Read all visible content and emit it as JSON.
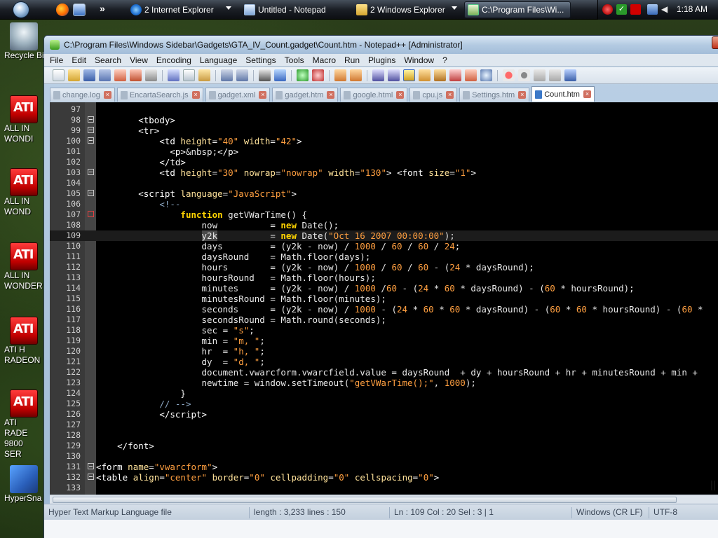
{
  "taskbar": {
    "quick_launch_chevron": "»",
    "buttons": [
      {
        "label": "2 Internet Explorer",
        "icon": "ie-icon"
      },
      {
        "label": "Untitled - Notepad",
        "icon": "notepad-icon"
      },
      {
        "label": "2 Windows Explorer",
        "icon": "folder-icon"
      },
      {
        "label": "C:\\Program Files\\Wi...",
        "icon": "folder-icon"
      }
    ],
    "clock": "1:18 AM"
  },
  "desktop_icons": [
    {
      "label": "Recycle Bi",
      "icon": "recycle-bin-icon"
    },
    {
      "badge": "ATI",
      "label": "ALL IN WONDI",
      "icon": "ati-icon"
    },
    {
      "badge": "ATI",
      "label": "ALL IN WOND",
      "icon": "ati-icon"
    },
    {
      "badge": "ATI",
      "label": "ALL IN WONDER",
      "icon": "ati-icon"
    },
    {
      "badge": "ATI",
      "label": "ATI H RADEON",
      "icon": "ati-icon"
    },
    {
      "badge": "ATI",
      "label": "ATI RADE 9800 SER",
      "icon": "ati-icon"
    },
    {
      "label": "HyperSna",
      "icon": "hypersnap-icon"
    }
  ],
  "window": {
    "title": "C:\\Program Files\\Windows Sidebar\\Gadgets\\GTA_IV_Count.gadget\\Count.htm - Notepad++ [Administrator]",
    "menu": [
      "File",
      "Edit",
      "Search",
      "View",
      "Encoding",
      "Language",
      "Settings",
      "Tools",
      "Macro",
      "Run",
      "Plugins",
      "Window",
      "?"
    ],
    "tabs": [
      {
        "label": "change.log",
        "active": false
      },
      {
        "label": "EncartaSearch.js",
        "active": false
      },
      {
        "label": "gadget.xml",
        "active": false
      },
      {
        "label": "gadget.htm",
        "active": false
      },
      {
        "label": "google.html",
        "active": false
      },
      {
        "label": "cpu.js",
        "active": false
      },
      {
        "label": "Settings.htm",
        "active": false
      },
      {
        "label": "Count.htm",
        "active": true
      }
    ],
    "status": {
      "filetype": "Hyper Text Markup Language file",
      "length": "length : 3,233    lines : 150",
      "position": "Ln : 109    Col : 20    Sel : 3 | 1",
      "eol": "Windows (CR LF)",
      "encoding": "UTF-8"
    }
  },
  "editor": {
    "current_line": 109,
    "lines": [
      {
        "n": "97",
        "fold": "",
        "html": ""
      },
      {
        "n": "98",
        "fold": "open",
        "html": "        <span class='tag'>&lt;tbody&gt;</span>"
      },
      {
        "n": "99",
        "fold": "open",
        "html": "        <span class='tag'>&lt;tr&gt;</span>"
      },
      {
        "n": "100",
        "fold": "open",
        "html": "            <span class='tag'>&lt;td</span> <span class='attr'>height</span>=<span class='str'>\"40\"</span> <span class='attr'>width</span>=<span class='str'>\"42\"</span><span class='tag'>&gt;</span>"
      },
      {
        "n": "101",
        "fold": "",
        "html": "              <span class='tag'>&lt;p&gt;</span>&amp;nbsp;<span class='tag'>&lt;/p&gt;</span>"
      },
      {
        "n": "102",
        "fold": "",
        "html": "            <span class='tag'>&lt;/td&gt;</span>"
      },
      {
        "n": "103",
        "fold": "open",
        "html": "            <span class='tag'>&lt;td</span> <span class='attr'>height</span>=<span class='str'>\"30\"</span> <span class='attr'>nowrap</span>=<span class='str'>\"nowrap\"</span> <span class='attr'>width</span>=<span class='str'>\"130\"</span><span class='tag'>&gt;</span> <span class='tag'>&lt;font</span> <span class='attr'>size</span>=<span class='str'>\"1\"</span><span class='tag'>&gt;</span>"
      },
      {
        "n": "104",
        "fold": "",
        "html": ""
      },
      {
        "n": "105",
        "fold": "open",
        "html": "        <span class='tag'>&lt;script</span> <span class='attr'>language</span>=<span class='str'>\"JavaScript\"</span><span class='tag'>&gt;</span>"
      },
      {
        "n": "106",
        "fold": "",
        "html": "            <span class='cmt'>&lt;!--</span>"
      },
      {
        "n": "107",
        "fold": "err",
        "html": "                <span class='kw'>function</span> getVWarTime() {"
      },
      {
        "n": "108",
        "fold": "",
        "html": "                    now          = <span class='kw'>new</span> Date();"
      },
      {
        "n": "109",
        "fold": "",
        "html": "                    <span class='sel'>y2k</span>          = <span class='kw'>new</span> Date(<span class='str'>\"Oct 16 2007 00:00:00\"</span>);"
      },
      {
        "n": "110",
        "fold": "",
        "html": "                    days         = (y2k - now) / <span class='num'>1000</span> / <span class='num'>60</span> / <span class='num'>60</span> / <span class='num'>24</span>;"
      },
      {
        "n": "111",
        "fold": "",
        "html": "                    daysRound    = Math.floor(days);"
      },
      {
        "n": "112",
        "fold": "",
        "html": "                    hours        = (y2k - now) / <span class='num'>1000</span> / <span class='num'>60</span> / <span class='num'>60</span> - (<span class='num'>24</span> * daysRound);"
      },
      {
        "n": "113",
        "fold": "",
        "html": "                    hoursRound   = Math.floor(hours);"
      },
      {
        "n": "114",
        "fold": "",
        "html": "                    minutes      = (y2k - now) / <span class='num'>1000</span> /<span class='num'>60</span> - (<span class='num'>24</span> * <span class='num'>60</span> * daysRound) - (<span class='num'>60</span> * hoursRound);"
      },
      {
        "n": "115",
        "fold": "",
        "html": "                    minutesRound = Math.floor(minutes);"
      },
      {
        "n": "116",
        "fold": "",
        "html": "                    seconds      = (y2k - now) / <span class='num'>1000</span> - (<span class='num'>24</span> * <span class='num'>60</span> * <span class='num'>60</span> * daysRound) - (<span class='num'>60</span> * <span class='num'>60</span> * hoursRound) - (<span class='num'>60</span> *"
      },
      {
        "n": "117",
        "fold": "",
        "html": "                    secondsRound = Math.round(seconds);"
      },
      {
        "n": "118",
        "fold": "",
        "html": "                    sec = <span class='str'>\"s\"</span>;"
      },
      {
        "n": "119",
        "fold": "",
        "html": "                    min = <span class='str'>\"m, \"</span>;"
      },
      {
        "n": "120",
        "fold": "",
        "html": "                    hr  = <span class='str'>\"h, \"</span>;"
      },
      {
        "n": "121",
        "fold": "",
        "html": "                    dy  = <span class='str'>\"d, \"</span>;"
      },
      {
        "n": "122",
        "fold": "",
        "html": "                    document.vwarcform.vwarcfield.value = daysRound  + dy + hoursRound + hr + minutesRound + min +"
      },
      {
        "n": "123",
        "fold": "",
        "html": "                    newtime = window.setTimeout(<span class='str'>\"getVWarTime();\"</span>, <span class='num'>1000</span>);"
      },
      {
        "n": "124",
        "fold": "",
        "html": "                }"
      },
      {
        "n": "125",
        "fold": "",
        "html": "            <span class='cmt'>// --&gt;</span>"
      },
      {
        "n": "126",
        "fold": "",
        "html": "            <span class='tag'>&lt;/script&gt;</span>"
      },
      {
        "n": "127",
        "fold": "",
        "html": ""
      },
      {
        "n": "128",
        "fold": "",
        "html": ""
      },
      {
        "n": "129",
        "fold": "",
        "html": "    <span class='tag'>&lt;/font&gt;</span>"
      },
      {
        "n": "130",
        "fold": "",
        "html": ""
      },
      {
        "n": "131",
        "fold": "open",
        "html": "<span class='tag'>&lt;form</span> <span class='attr'>name</span>=<span class='str'>\"vwarcform\"</span><span class='tag'>&gt;</span>"
      },
      {
        "n": "132",
        "fold": "open",
        "html": "<span class='tag'>&lt;table</span> <span class='attr'>align</span>=<span class='str'>\"center\"</span> <span class='attr'>border</span>=<span class='str'>\"0\"</span> <span class='attr'>cellpadding</span>=<span class='str'>\"0\"</span> <span class='attr'>cellspacing</span>=<span class='str'>\"0\"</span><span class='tag'>&gt;</span>"
      },
      {
        "n": "133",
        "fold": "",
        "html": ""
      }
    ]
  }
}
